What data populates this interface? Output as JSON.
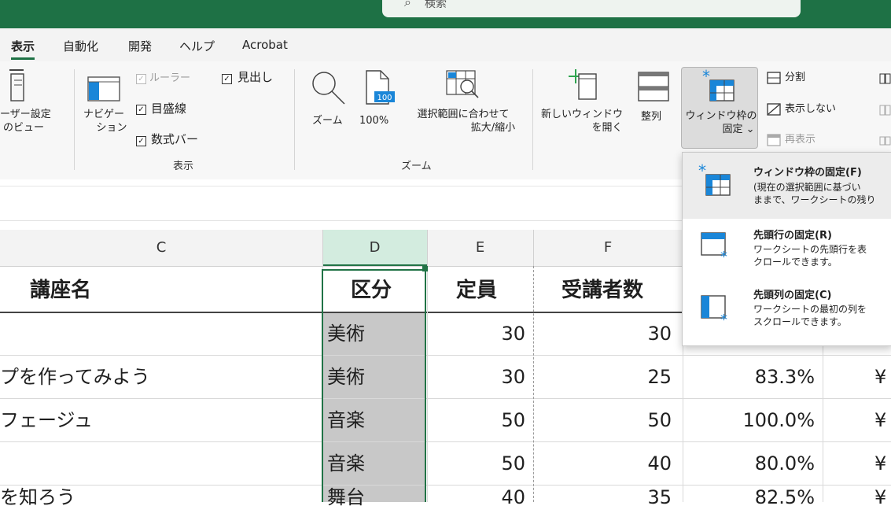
{
  "search": {
    "placeholder": "検索"
  },
  "tabs": [
    "表示",
    "自動化",
    "開発",
    "ヘルプ",
    "Acrobat"
  ],
  "ribbon": {
    "user_view": [
      "ーザー設定",
      "のビュー"
    ],
    "navigation": [
      "ナビゲー",
      "ション"
    ],
    "ruler": "ルーラー",
    "gridlines": "目盛線",
    "formula_bar": "数式バー",
    "headings": "見出し",
    "group_show": "表示",
    "zoom": "ズーム",
    "zoom100_badge": "100",
    "zoom100": "100%",
    "zoom_selection": [
      "選択範囲に合わせて",
      "拡大/縮小"
    ],
    "group_zoom": "ズーム",
    "new_window": [
      "新しいウィンドウ",
      "を開く"
    ],
    "arrange_all": "整列",
    "freeze_panes": [
      "ウィンドウ枠の",
      "固定 ⌄"
    ],
    "split": "分割",
    "hide": "表示しない",
    "unhide": "再表示"
  },
  "columns": [
    "C",
    "D",
    "E",
    "F"
  ],
  "header_row": {
    "c": "講座名",
    "d": "区分",
    "e": "定員",
    "f": "受講者数"
  },
  "rows": [
    {
      "c": "",
      "d": "美術",
      "e": "30",
      "f": "30",
      "g": "",
      "h": ""
    },
    {
      "c": "プを作ってみよう",
      "d": "美術",
      "e": "30",
      "f": "25",
      "g": "83.3%",
      "h": "¥"
    },
    {
      "c": "フェージュ",
      "d": "音楽",
      "e": "50",
      "f": "50",
      "g": "100.0%",
      "h": "¥"
    },
    {
      "c": "",
      "d": "音楽",
      "e": "50",
      "f": "40",
      "g": "80.0%",
      "h": "¥"
    }
  ],
  "partial_row": {
    "c": "を知ろう",
    "d": "舞台",
    "e": "40",
    "f": "35",
    "g": "82.5%",
    "h": "¥"
  },
  "dropdown": {
    "items": [
      {
        "title": "ウィンドウ枠の固定(F)",
        "desc": "(現在の選択範囲に基づい\nままで、ワークシートの残り"
      },
      {
        "title": "先頭行の固定(R)",
        "desc": "ワークシートの先頭行を表\nクロールできます。"
      },
      {
        "title": "先頭列の固定(C)",
        "desc": "ワークシートの最初の列を\nスクロールできます。"
      }
    ]
  },
  "colors": {
    "excel_green": "#1e7145",
    "selection_green": "#217346",
    "freeze_blue": "#1a86d8"
  }
}
